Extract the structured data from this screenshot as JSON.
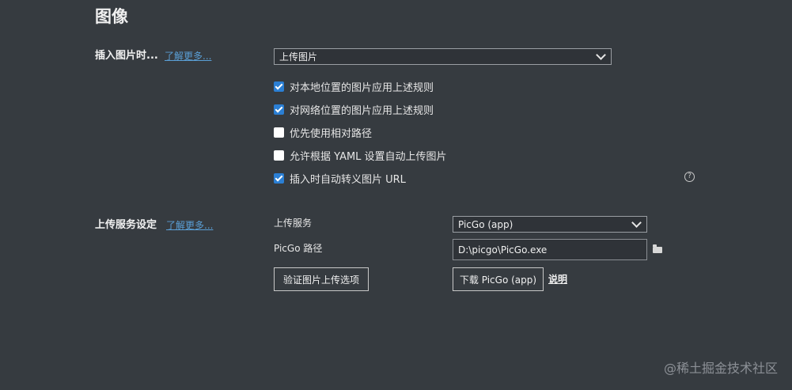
{
  "page": {
    "title": "图像"
  },
  "insert_image": {
    "label": "插入图片时...",
    "learn_more": "了解更多...",
    "action_select": {
      "value": "上传图片"
    },
    "checkboxes": [
      {
        "label": "对本地位置的图片应用上述规则",
        "checked": true
      },
      {
        "label": "对网络位置的图片应用上述规则",
        "checked": true
      },
      {
        "label": "优先使用相对路径",
        "checked": false
      },
      {
        "label": "允许根据 YAML 设置自动上传图片",
        "checked": false
      },
      {
        "label": "插入时自动转义图片 URL",
        "checked": true
      }
    ],
    "help_glyph": "?"
  },
  "upload_service": {
    "label": "上传服务设定",
    "learn_more": "了解更多...",
    "service_label": "上传服务",
    "service_select": {
      "value": "PicGo (app)"
    },
    "path_label": "PicGo 路径",
    "path_value": "D:\\picgo\\PicGo.exe",
    "verify_button": "验证图片上传选项",
    "download_button": "下载 PicGo (app)",
    "docs_link": "说明"
  },
  "watermark": "@稀土掘金技术社区",
  "colors": {
    "background": "#363b40",
    "link": "#5a9fd6",
    "checkbox_checked": "#2b7fd4"
  }
}
